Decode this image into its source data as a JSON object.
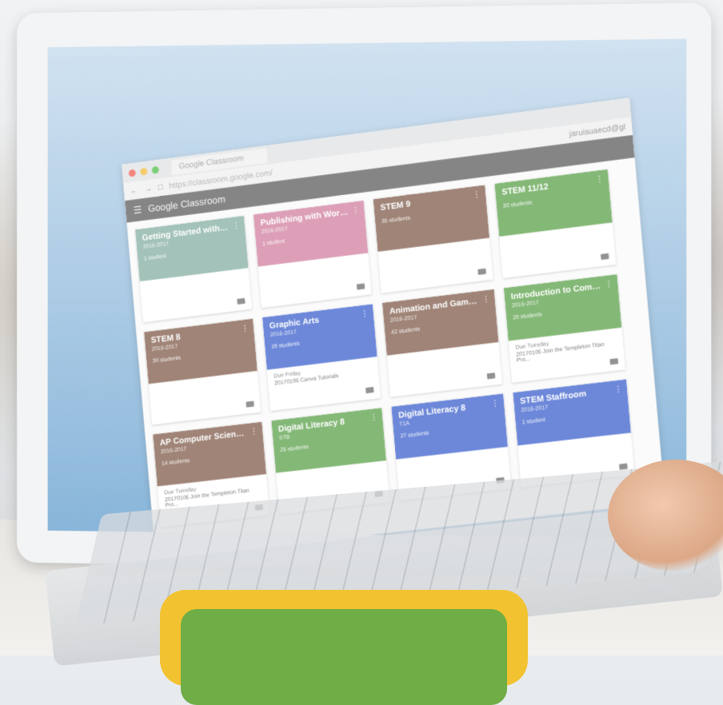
{
  "browser": {
    "tab_title": "Google Classroom",
    "url": "https://classroom.google.com/",
    "account": "jaruisuaecd@gl"
  },
  "app": {
    "name": "Google Classroom"
  },
  "colors": {
    "teal": "#8fb5aa",
    "pink": "#d58aa8",
    "brown": "#8b6a5a",
    "green": "#6aa95a",
    "blue": "#4d6ed1",
    "appbar": "#6b6b6b",
    "badge_outer": "#f2c230",
    "badge_inner": "#6fad46"
  },
  "courses": [
    {
      "title": "Getting Started with Onli...",
      "year": "2016-2017",
      "count": "1 student",
      "color": "#8fb5aa",
      "due_label": "",
      "due_text": ""
    },
    {
      "title": "Publishing with Wordpress",
      "year": "2016-2017",
      "count": "1 student",
      "color": "#d58aa8",
      "due_label": "",
      "due_text": ""
    },
    {
      "title": "STEM 9",
      "year": "",
      "count": "35 students",
      "color": "#8b6a5a",
      "due_label": "",
      "due_text": ""
    },
    {
      "title": "STEM 11/12",
      "year": "",
      "count": "30 students",
      "color": "#6aa95a",
      "due_label": "",
      "due_text": ""
    },
    {
      "title": "STEM 8",
      "year": "2016-2017",
      "count": "30 students",
      "color": "#8b6a5a",
      "due_label": "",
      "due_text": ""
    },
    {
      "title": "Graphic Arts",
      "year": "2016-2017",
      "count": "18 students",
      "color": "#4d6ed1",
      "due_label": "Due Friday",
      "due_text": "20170106 Canva Tutorials"
    },
    {
      "title": "Animation and Game Des...",
      "year": "2016-2017",
      "count": "42 students",
      "color": "#8b6a5a",
      "due_label": "",
      "due_text": ""
    },
    {
      "title": "Introduction to Computer...",
      "year": "2016-2017",
      "count": "20 students",
      "color": "#6aa95a",
      "due_label": "Due Tuesday",
      "due_text": "20170106 Join the Templeton Titan Pro..."
    },
    {
      "title": "AP Computer Science Pri...",
      "year": "2016-2017",
      "count": "14 students",
      "color": "#8b6a5a",
      "due_label": "Due Tuesday",
      "due_text": "20170106 Join the Templeton Titan Pro..."
    },
    {
      "title": "Digital Literacy 8",
      "year": "STB",
      "count": "26 students",
      "color": "#6aa95a",
      "due_label": "",
      "due_text": ""
    },
    {
      "title": "Digital Literacy 8",
      "year": "T1A",
      "count": "27 students",
      "color": "#4d6ed1",
      "due_label": "",
      "due_text": ""
    },
    {
      "title": "STEM Staffroom",
      "year": "2016-2017",
      "count": "1 student",
      "color": "#4d6ed1",
      "due_label": "",
      "due_text": ""
    }
  ]
}
